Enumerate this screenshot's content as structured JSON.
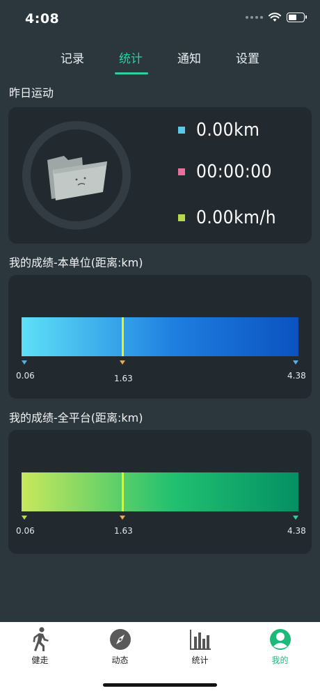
{
  "status_bar": {
    "time": "4:08"
  },
  "tabs": [
    {
      "label": "记录",
      "active": false
    },
    {
      "label": "统计",
      "active": true
    },
    {
      "label": "通知",
      "active": false
    },
    {
      "label": "设置",
      "active": false
    }
  ],
  "yesterday": {
    "title": "昨日运动",
    "stats": [
      {
        "value": "0.00km",
        "color": "#5bc8ea"
      },
      {
        "value": "00:00:00",
        "color": "#ea6f9c"
      },
      {
        "value": "0.00km/h",
        "color": "#b5d84e"
      }
    ]
  },
  "unit_score": {
    "title": "我的成绩-本单位(距离:km)",
    "min_label": "0.06",
    "marker_label": "1.63",
    "max_label": "4.38",
    "min": 0.06,
    "marker": 1.63,
    "max": 4.38,
    "gradient": [
      "#5ee0f7",
      "#1f7fe0",
      "#0b52c0"
    ],
    "tick_color": "#4ab3f0",
    "marker_tick_color": "#f0a84a"
  },
  "platform_score": {
    "title": "我的成绩-全平台(距离:km)",
    "min_label": "0.06",
    "marker_label": "1.63",
    "max_label": "4.38",
    "min": 0.06,
    "marker": 1.63,
    "max": 4.38,
    "gradient": [
      "#c8e85c",
      "#20c070",
      "#049064"
    ],
    "tick_color": "#b9d84e",
    "marker_tick_color": "#f0a84a",
    "end_tick_color": "#2fd0a0"
  },
  "bottom_nav": [
    {
      "label": "健走",
      "icon": "walker-icon",
      "active": false
    },
    {
      "label": "动态",
      "icon": "compass-icon",
      "active": false
    },
    {
      "label": "统计",
      "icon": "bar-chart-icon",
      "active": false
    },
    {
      "label": "我的",
      "icon": "user-icon",
      "active": true
    }
  ]
}
